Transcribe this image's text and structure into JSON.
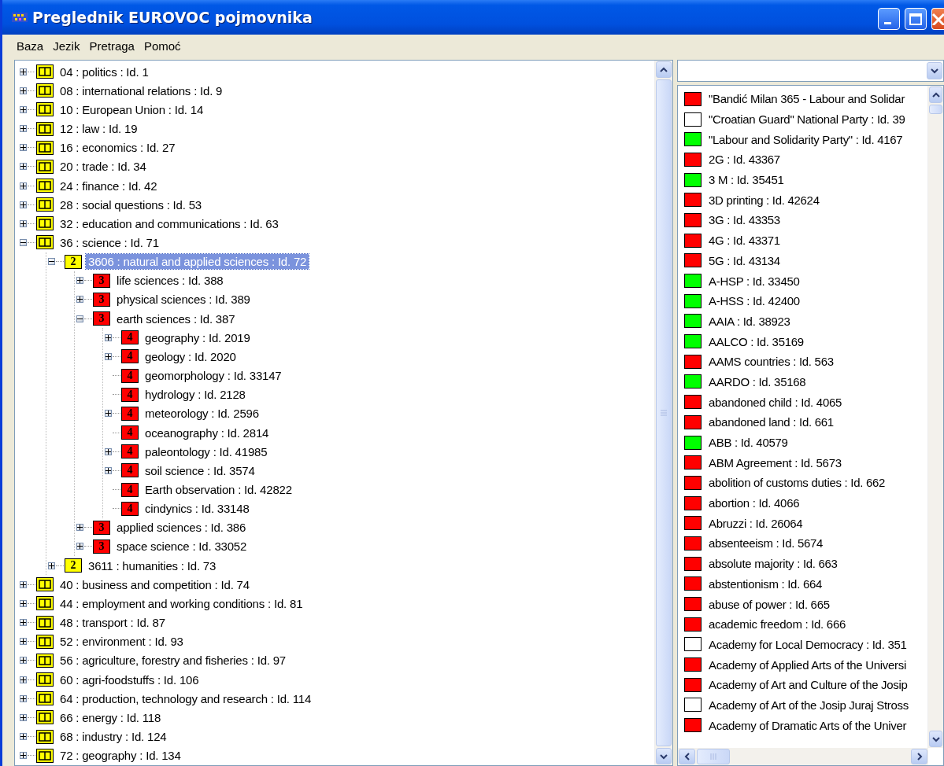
{
  "window": {
    "title": "Preglednik EUROVOC pojmovnika"
  },
  "menu": [
    "Baza",
    "Jezik",
    "Pretraga",
    "Pomoć"
  ],
  "tree": [
    {
      "label": "04 : politics : Id. 1",
      "kind": "book",
      "expandable": true,
      "expanded": false,
      "selected": false
    },
    {
      "label": "08 : international relations : Id. 9",
      "kind": "book",
      "expandable": true,
      "expanded": false,
      "selected": false
    },
    {
      "label": "10 : European Union : Id. 14",
      "kind": "book",
      "expandable": true,
      "expanded": false,
      "selected": false
    },
    {
      "label": "12 : law : Id. 19",
      "kind": "book",
      "expandable": true,
      "expanded": false,
      "selected": false
    },
    {
      "label": "16 : economics : Id. 27",
      "kind": "book",
      "expandable": true,
      "expanded": false,
      "selected": false
    },
    {
      "label": "20 : trade : Id. 34",
      "kind": "book",
      "expandable": true,
      "expanded": false,
      "selected": false
    },
    {
      "label": "24 : finance : Id. 42",
      "kind": "book",
      "expandable": true,
      "expanded": false,
      "selected": false
    },
    {
      "label": "28 : social questions : Id. 53",
      "kind": "book",
      "expandable": true,
      "expanded": false,
      "selected": false
    },
    {
      "label": "32 : education and communications : Id. 63",
      "kind": "book",
      "expandable": true,
      "expanded": false,
      "selected": false
    },
    {
      "label": "36 : science : Id. 71",
      "kind": "book",
      "expandable": true,
      "expanded": true,
      "selected": false,
      "children": [
        {
          "label": "3606 : natural and applied sciences : Id. 72",
          "kind": "badge",
          "badge": "2",
          "color": "#ffff00",
          "expandable": true,
          "expanded": true,
          "selected": true,
          "children": [
            {
              "label": "life sciences : Id. 388",
              "kind": "badge",
              "badge": "3",
              "color": "#ff0000",
              "expandable": true,
              "expanded": false,
              "selected": false
            },
            {
              "label": "physical sciences : Id. 389",
              "kind": "badge",
              "badge": "3",
              "color": "#ff0000",
              "expandable": true,
              "expanded": false,
              "selected": false
            },
            {
              "label": "earth sciences : Id. 387",
              "kind": "badge",
              "badge": "3",
              "color": "#ff0000",
              "expandable": true,
              "expanded": true,
              "selected": false,
              "children": [
                {
                  "label": "geography : Id. 2019",
                  "kind": "badge",
                  "badge": "4",
                  "color": "#ff0000",
                  "expandable": true,
                  "expanded": false,
                  "selected": false
                },
                {
                  "label": "geology : Id. 2020",
                  "kind": "badge",
                  "badge": "4",
                  "color": "#ff0000",
                  "expandable": true,
                  "expanded": false,
                  "selected": false
                },
                {
                  "label": "geomorphology : Id. 33147",
                  "kind": "badge",
                  "badge": "4",
                  "color": "#ff0000",
                  "expandable": false,
                  "selected": false
                },
                {
                  "label": "hydrology : Id. 2128",
                  "kind": "badge",
                  "badge": "4",
                  "color": "#ff0000",
                  "expandable": false,
                  "selected": false
                },
                {
                  "label": "meteorology : Id. 2596",
                  "kind": "badge",
                  "badge": "4",
                  "color": "#ff0000",
                  "expandable": true,
                  "expanded": false,
                  "selected": false
                },
                {
                  "label": "oceanography : Id. 2814",
                  "kind": "badge",
                  "badge": "4",
                  "color": "#ff0000",
                  "expandable": false,
                  "selected": false
                },
                {
                  "label": "paleontology : Id. 41985",
                  "kind": "badge",
                  "badge": "4",
                  "color": "#ff0000",
                  "expandable": true,
                  "expanded": false,
                  "selected": false
                },
                {
                  "label": "soil science : Id. 3574",
                  "kind": "badge",
                  "badge": "4",
                  "color": "#ff0000",
                  "expandable": true,
                  "expanded": false,
                  "selected": false
                },
                {
                  "label": "Earth observation : Id. 42822",
                  "kind": "badge",
                  "badge": "4",
                  "color": "#ff0000",
                  "expandable": false,
                  "selected": false
                },
                {
                  "label": "cindynics : Id. 33148",
                  "kind": "badge",
                  "badge": "4",
                  "color": "#ff0000",
                  "expandable": false,
                  "selected": false
                }
              ]
            },
            {
              "label": "applied sciences : Id. 386",
              "kind": "badge",
              "badge": "3",
              "color": "#ff0000",
              "expandable": true,
              "expanded": false,
              "selected": false
            },
            {
              "label": "space science : Id. 33052",
              "kind": "badge",
              "badge": "3",
              "color": "#ff0000",
              "expandable": true,
              "expanded": false,
              "selected": false
            }
          ]
        },
        {
          "label": "3611 : humanities : Id. 73",
          "kind": "badge",
          "badge": "2",
          "color": "#ffff00",
          "expandable": true,
          "expanded": false,
          "selected": false
        }
      ]
    },
    {
      "label": "40 : business and competition : Id. 74",
      "kind": "book",
      "expandable": true,
      "expanded": false,
      "selected": false
    },
    {
      "label": "44 : employment and working conditions : Id. 81",
      "kind": "book",
      "expandable": true,
      "expanded": false,
      "selected": false
    },
    {
      "label": "48 : transport : Id. 87",
      "kind": "book",
      "expandable": true,
      "expanded": false,
      "selected": false
    },
    {
      "label": "52 : environment : Id. 93",
      "kind": "book",
      "expandable": true,
      "expanded": false,
      "selected": false
    },
    {
      "label": "56 : agriculture, forestry and fisheries : Id. 97",
      "kind": "book",
      "expandable": true,
      "expanded": false,
      "selected": false
    },
    {
      "label": "60 : agri-foodstuffs : Id. 106",
      "kind": "book",
      "expandable": true,
      "expanded": false,
      "selected": false
    },
    {
      "label": "64 : production, technology and research : Id. 114",
      "kind": "book",
      "expandable": true,
      "expanded": false,
      "selected": false
    },
    {
      "label": "66 : energy : Id. 118",
      "kind": "book",
      "expandable": true,
      "expanded": false,
      "selected": false
    },
    {
      "label": "68 : industry : Id. 124",
      "kind": "book",
      "expandable": true,
      "expanded": false,
      "selected": false
    },
    {
      "label": "72 : geography : Id. 134",
      "kind": "book",
      "expandable": true,
      "expanded": false,
      "selected": false
    }
  ],
  "terms": [
    {
      "label": "\"Bandić Milan 365 - Labour and Solidar",
      "color": "#ff0000"
    },
    {
      "label": "\"Croatian Guard\" National Party : Id. 39",
      "color": "#ffffff"
    },
    {
      "label": "\"Labour and Solidarity Party\" : Id. 4167",
      "color": "#00ff00"
    },
    {
      "label": "2G : Id. 43367",
      "color": "#ff0000"
    },
    {
      "label": "3 M : Id. 35451",
      "color": "#00ff00"
    },
    {
      "label": "3D printing : Id. 42624",
      "color": "#ff0000"
    },
    {
      "label": "3G : Id. 43353",
      "color": "#ff0000"
    },
    {
      "label": "4G : Id. 43371",
      "color": "#ff0000"
    },
    {
      "label": "5G : Id. 43134",
      "color": "#ff0000"
    },
    {
      "label": "A-HSP : Id. 33450",
      "color": "#00ff00"
    },
    {
      "label": "A-HSS : Id. 42400",
      "color": "#00ff00"
    },
    {
      "label": "AAIA : Id. 38923",
      "color": "#00ff00"
    },
    {
      "label": "AALCO : Id. 35169",
      "color": "#00ff00"
    },
    {
      "label": "AAMS countries : Id. 563",
      "color": "#ff0000"
    },
    {
      "label": "AARDO : Id. 35168",
      "color": "#00ff00"
    },
    {
      "label": "abandoned child : Id. 4065",
      "color": "#ff0000"
    },
    {
      "label": "abandoned land : Id. 661",
      "color": "#ff0000"
    },
    {
      "label": "ABB : Id. 40579",
      "color": "#00ff00"
    },
    {
      "label": "ABM Agreement : Id. 5673",
      "color": "#ff0000"
    },
    {
      "label": "abolition of customs duties : Id. 662",
      "color": "#ff0000"
    },
    {
      "label": "abortion : Id. 4066",
      "color": "#ff0000"
    },
    {
      "label": "Abruzzi : Id. 26064",
      "color": "#ff0000"
    },
    {
      "label": "absenteeism : Id. 5674",
      "color": "#ff0000"
    },
    {
      "label": "absolute majority : Id. 663",
      "color": "#ff0000"
    },
    {
      "label": "abstentionism : Id. 664",
      "color": "#ff0000"
    },
    {
      "label": "abuse of power : Id. 665",
      "color": "#ff0000"
    },
    {
      "label": "academic freedom : Id. 666",
      "color": "#ff0000"
    },
    {
      "label": "Academy for Local Democracy : Id. 351",
      "color": "#ffffff"
    },
    {
      "label": "Academy of Applied Arts of the Universi",
      "color": "#ff0000"
    },
    {
      "label": "Academy of Art and Culture of the Josip",
      "color": "#ff0000"
    },
    {
      "label": "Academy of Art of the Josip Juraj Stross",
      "color": "#ffffff"
    },
    {
      "label": "Academy of Dramatic Arts of the Univer",
      "color": "#ff0000"
    }
  ]
}
